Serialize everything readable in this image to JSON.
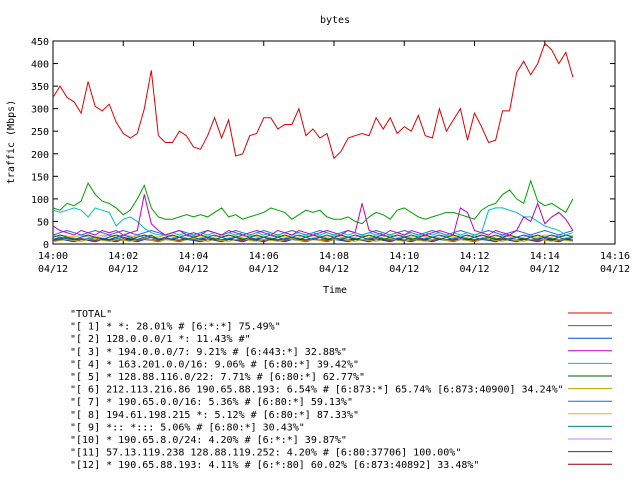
{
  "chart_data": {
    "type": "line",
    "title": "bytes",
    "xlabel": "Time",
    "ylabel": "traffic (Mbps)",
    "ylim": [
      0,
      450
    ],
    "yticks": [
      0,
      50,
      100,
      150,
      200,
      250,
      300,
      350,
      400,
      450
    ],
    "xlim_minutes": [
      0,
      16
    ],
    "xticks": [
      {
        "time": "14:00",
        "date": "04/12"
      },
      {
        "time": "14:02",
        "date": "04/12"
      },
      {
        "time": "14:04",
        "date": "04/12"
      },
      {
        "time": "14:06",
        "date": "04/12"
      },
      {
        "time": "14:08",
        "date": "04/12"
      },
      {
        "time": "14:10",
        "date": "04/12"
      },
      {
        "time": "14:12",
        "date": "04/12"
      },
      {
        "time": "14:14",
        "date": "04/12"
      },
      {
        "time": "14:16",
        "date": "04/12"
      }
    ],
    "x_minutes": [
      0,
      0.2,
      0.4,
      0.6,
      0.8,
      1,
      1.2,
      1.4,
      1.6,
      1.8,
      2,
      2.2,
      2.4,
      2.6,
      2.8,
      3,
      3.2,
      3.4,
      3.6,
      3.8,
      4,
      4.2,
      4.4,
      4.6,
      4.8,
      5,
      5.2,
      5.4,
      5.6,
      5.8,
      6,
      6.2,
      6.4,
      6.6,
      6.8,
      7,
      7.2,
      7.4,
      7.6,
      7.8,
      8,
      8.2,
      8.4,
      8.6,
      8.8,
      9,
      9.2,
      9.4,
      9.6,
      9.8,
      10,
      10.2,
      10.4,
      10.6,
      10.8,
      11,
      11.2,
      11.4,
      11.6,
      11.8,
      12,
      12.2,
      12.4,
      12.6,
      12.8,
      13,
      13.2,
      13.4,
      13.6,
      13.8,
      14,
      14.2,
      14.4,
      14.6,
      14.8
    ],
    "series": [
      {
        "name": "\"TOTAL\"",
        "color": "#e00000",
        "values": [
          325,
          350,
          325,
          315,
          290,
          360,
          305,
          295,
          310,
          270,
          245,
          235,
          245,
          300,
          385,
          240,
          225,
          225,
          250,
          240,
          215,
          210,
          240,
          280,
          235,
          275,
          195,
          200,
          240,
          245,
          280,
          280,
          255,
          265,
          265,
          300,
          240,
          255,
          235,
          245,
          190,
          205,
          235,
          240,
          245,
          240,
          280,
          255,
          280,
          245,
          260,
          250,
          285,
          240,
          235,
          300,
          250,
          275,
          300,
          230,
          290,
          260,
          225,
          230,
          295,
          295,
          380,
          405,
          375,
          400,
          445,
          430,
          400,
          425,
          370,
          365,
          335,
          310,
          375,
          370,
          360,
          270,
          385,
          375,
          355,
          350,
          345,
          365,
          310
        ]
      },
      {
        "name": "\"[ 1] * *: 28.01% # [6:*:*] 75.49%\"",
        "color": "#00a000",
        "values": [
          80,
          75,
          90,
          85,
          95,
          135,
          110,
          95,
          90,
          80,
          65,
          75,
          100,
          130,
          80,
          60,
          55,
          55,
          60,
          65,
          60,
          65,
          60,
          70,
          80,
          60,
          65,
          55,
          60,
          65,
          70,
          80,
          75,
          70,
          55,
          65,
          75,
          70,
          75,
          60,
          55,
          55,
          60,
          50,
          45,
          60,
          70,
          65,
          55,
          75,
          80,
          70,
          60,
          55,
          60,
          65,
          70,
          70,
          65,
          60,
          55,
          75,
          85,
          90,
          110,
          120,
          100,
          90,
          140,
          95,
          85,
          90,
          80,
          70,
          100,
          115,
          80,
          95,
          110,
          90,
          110,
          100,
          110,
          95
        ]
      },
      {
        "name": "\"[ 2] 128.0.0.0/1 *: 11.43% #\"",
        "color": "#0055cc",
        "values": [
          10,
          15,
          12,
          10,
          15,
          20,
          15,
          12,
          10,
          15,
          20,
          15,
          10,
          15,
          20,
          10,
          15,
          10,
          15,
          20,
          15,
          10,
          15,
          20,
          15,
          10,
          15,
          20,
          15,
          10,
          15,
          20,
          15,
          10,
          15,
          20,
          15,
          10,
          15,
          20,
          15,
          10,
          15,
          20,
          15,
          10,
          15,
          20,
          15,
          10,
          15,
          20,
          15,
          10,
          15,
          20,
          15,
          10,
          15,
          20,
          15,
          10,
          15,
          20,
          15,
          10,
          15,
          20,
          15,
          10,
          15,
          20,
          15,
          10,
          15,
          20,
          15,
          10,
          15,
          20,
          15,
          10,
          15,
          20,
          15
        ]
      },
      {
        "name": "\"[ 3] * 194.0.0.0/7: 9.21% # [6:443:*] 32.88%\"",
        "color": "#c000c0",
        "values": [
          40,
          30,
          25,
          20,
          30,
          25,
          20,
          30,
          25,
          30,
          20,
          25,
          30,
          110,
          45,
          30,
          20,
          25,
          30,
          20,
          25,
          20,
          30,
          25,
          20,
          30,
          25,
          20,
          25,
          30,
          25,
          20,
          30,
          25,
          20,
          30,
          25,
          20,
          25,
          30,
          25,
          20,
          30,
          25,
          90,
          30,
          25,
          20,
          30,
          25,
          20,
          30,
          25,
          20,
          25,
          30,
          25,
          20,
          80,
          70,
          30,
          25,
          20,
          30,
          25,
          20,
          30,
          60,
          50,
          90,
          45,
          60,
          70,
          55,
          30,
          20,
          25,
          40,
          60,
          55,
          35,
          45,
          60,
          45
        ]
      },
      {
        "name": "\"[ 4] * 163.201.0.0/16: 9.06% # [6:80:*] 39.42%\"",
        "color": "#00c0c0",
        "values": [
          75,
          70,
          75,
          80,
          75,
          60,
          80,
          75,
          70,
          40,
          55,
          60,
          50,
          35,
          25,
          20,
          20,
          25,
          20,
          25,
          20,
          25,
          20,
          25,
          20,
          25,
          20,
          25,
          20,
          25,
          20,
          25,
          20,
          25,
          20,
          25,
          20,
          25,
          20,
          25,
          20,
          25,
          20,
          25,
          20,
          25,
          20,
          25,
          20,
          25,
          20,
          25,
          20,
          25,
          20,
          25,
          20,
          25,
          20,
          25,
          20,
          25,
          75,
          80,
          80,
          75,
          70,
          60,
          60,
          50,
          40,
          35,
          30,
          20,
          25,
          30,
          25,
          30,
          25,
          20,
          25,
          30,
          20,
          25
        ]
      },
      {
        "name": "\"[ 5] * 128.88.116.0/22: 7.71% # [6:80:*] 62.77%\"",
        "color": "#006000",
        "values": [
          15,
          20,
          15,
          10,
          15,
          20,
          15,
          10,
          15,
          20,
          15,
          10,
          15,
          20,
          15,
          10,
          15,
          20,
          15,
          10,
          15,
          20,
          15,
          10,
          15,
          20,
          15,
          10,
          15,
          20,
          15,
          10,
          15,
          20,
          15,
          10,
          15,
          20,
          15,
          10,
          15,
          20,
          15,
          10,
          15,
          20,
          15,
          10,
          15,
          20,
          15,
          10,
          15,
          20,
          15,
          10,
          15,
          20,
          15,
          10,
          15,
          20,
          15,
          10,
          15,
          20,
          15,
          10,
          15,
          20,
          15,
          10,
          15,
          20,
          15,
          10,
          15,
          20,
          15,
          10,
          15,
          20,
          15,
          10
        ]
      },
      {
        "name": "\"[ 6] 212.113.216.86 190.65.88.193: 6.54% # [6:873:*] 65.74% [6:873:40900] 34.24%\"",
        "color": "#c0a000",
        "values": [
          5,
          8,
          10,
          8,
          6,
          10,
          12,
          8,
          6,
          10,
          8,
          6,
          10,
          12,
          8,
          6,
          10,
          8,
          6,
          10,
          12,
          8,
          6,
          10,
          8,
          6,
          10,
          12,
          8,
          6,
          10,
          8,
          6,
          10,
          12,
          8,
          6,
          10,
          8,
          6,
          10,
          12,
          8,
          6,
          10,
          8,
          6,
          10,
          12,
          8,
          6,
          10,
          8,
          6,
          10,
          12,
          8,
          6,
          10,
          8,
          6,
          10,
          12,
          8,
          6,
          10,
          8,
          6,
          10,
          12,
          8,
          6,
          10,
          8,
          6,
          10,
          12,
          8,
          6,
          10,
          8,
          6,
          10,
          12
        ]
      },
      {
        "name": "\"[ 7] * 190.65.0.0/16: 5.36% # [6:80:*] 59.13%\"",
        "color": "#2060e0",
        "values": [
          20,
          25,
          30,
          25,
          20,
          25,
          30,
          25,
          20,
          25,
          30,
          25,
          20,
          25,
          30,
          25,
          20,
          25,
          30,
          25,
          20,
          25,
          30,
          25,
          20,
          25,
          30,
          25,
          20,
          25,
          30,
          25,
          20,
          25,
          30,
          25,
          20,
          25,
          30,
          25,
          20,
          25,
          30,
          25,
          20,
          25,
          30,
          25,
          20,
          25,
          30,
          25,
          20,
          25,
          30,
          25,
          20,
          25,
          30,
          25,
          20,
          25,
          30,
          25,
          20,
          25,
          30,
          25,
          20,
          25,
          30,
          25,
          20,
          25,
          30,
          25,
          20,
          25,
          30,
          25,
          20,
          25,
          30,
          25
        ]
      },
      {
        "name": "\"[ 8] 194.61.198.215 *: 5.12% # [6:80:*] 87.33%\"",
        "color": "#ffb000",
        "values": [
          15,
          20,
          18,
          15,
          20,
          18,
          15,
          20,
          18,
          15,
          20,
          18,
          15,
          20,
          18,
          15,
          20,
          18,
          15,
          20,
          18,
          15,
          20,
          18,
          15,
          20,
          18,
          15,
          20,
          18,
          15,
          20,
          18,
          15,
          20,
          18,
          15,
          20,
          18,
          15,
          20,
          18,
          15,
          20,
          18,
          15,
          20,
          18,
          15,
          20,
          18,
          15,
          20,
          18,
          15,
          20,
          18,
          15,
          20,
          18,
          15,
          20,
          18,
          15,
          20,
          18,
          15,
          20,
          18,
          15,
          20,
          18,
          15,
          20,
          18,
          15,
          20,
          18,
          15,
          20,
          18,
          15,
          20,
          18
        ]
      },
      {
        "name": "\"[ 9] *:: *::: 5.06% # [6:80:*] 30.43%\"",
        "color": "#008080",
        "values": [
          10,
          12,
          15,
          12,
          10,
          12,
          15,
          12,
          10,
          12,
          15,
          12,
          10,
          12,
          15,
          12,
          10,
          12,
          15,
          12,
          10,
          12,
          15,
          12,
          10,
          12,
          15,
          12,
          10,
          12,
          15,
          12,
          10,
          12,
          15,
          12,
          10,
          12,
          15,
          12,
          10,
          12,
          15,
          12,
          10,
          12,
          15,
          12,
          10,
          12,
          15,
          12,
          10,
          12,
          15,
          12,
          10,
          12,
          15,
          12,
          10,
          12,
          15,
          12,
          10,
          12,
          15,
          12,
          10,
          12,
          15,
          12,
          10,
          12,
          15,
          12,
          10,
          12,
          15,
          12,
          10,
          12,
          15,
          12
        ]
      },
      {
        "name": "\"[10] * 190.65.8.0/24: 4.20% # [6:*:*] 39.87%\"",
        "color": "#c080ff",
        "values": [
          20,
          15,
          10,
          15,
          20,
          15,
          10,
          15,
          20,
          15,
          10,
          15,
          20,
          15,
          10,
          15,
          20,
          15,
          10,
          15,
          20,
          15,
          10,
          15,
          20,
          15,
          10,
          15,
          20,
          15,
          10,
          15,
          20,
          15,
          10,
          15,
          20,
          15,
          10,
          15,
          20,
          15,
          10,
          15,
          20,
          15,
          10,
          15,
          20,
          15,
          10,
          15,
          20,
          15,
          10,
          15,
          20,
          15,
          10,
          15,
          20,
          15,
          10,
          15,
          20,
          15,
          10,
          15,
          20,
          15,
          10,
          15,
          20,
          15,
          10,
          15,
          20,
          15,
          10,
          15,
          20,
          15,
          10,
          15
        ]
      },
      {
        "name": "\"[11] 57.13.119.238 128.88.119.252: 4.20% # [6:80:37706] 100.00%\"",
        "color": "#1040a0",
        "values": [
          5,
          10,
          8,
          5,
          10,
          8,
          5,
          10,
          8,
          5,
          10,
          8,
          5,
          10,
          8,
          5,
          10,
          8,
          5,
          10,
          8,
          5,
          10,
          8,
          5,
          10,
          8,
          5,
          10,
          8,
          5,
          10,
          8,
          5,
          10,
          8,
          5,
          10,
          8,
          5,
          10,
          8,
          5,
          10,
          8,
          5,
          10,
          8,
          5,
          10,
          8,
          5,
          10,
          8,
          5,
          10,
          8,
          5,
          10,
          8,
          5,
          10,
          8,
          5,
          10,
          8,
          5,
          10,
          8,
          5,
          10,
          8,
          5,
          10,
          8,
          5,
          10,
          8,
          5,
          10,
          8,
          5,
          10,
          8
        ]
      },
      {
        "name": "\"[12] * 190.65.88.193: 4.11% # [6:*:80] 60.02% [6:873:40892] 33.48%\"",
        "color": "#900000",
        "values": [
          8,
          12,
          10,
          8,
          12,
          10,
          8,
          12,
          10,
          8,
          12,
          10,
          8,
          12,
          10,
          8,
          12,
          10,
          8,
          12,
          10,
          8,
          12,
          10,
          8,
          12,
          10,
          8,
          12,
          10,
          8,
          12,
          10,
          8,
          12,
          10,
          8,
          12,
          10,
          8,
          12,
          10,
          8,
          12,
          10,
          8,
          12,
          10,
          8,
          12,
          10,
          8,
          12,
          10,
          8,
          12,
          10,
          8,
          12,
          10,
          8,
          12,
          10,
          8,
          12,
          10,
          8,
          12,
          10,
          8,
          12,
          10,
          8,
          12,
          10,
          8,
          12,
          10,
          8,
          12,
          10,
          8,
          12,
          10
        ]
      }
    ],
    "grid": false,
    "legend_position": "bottom"
  }
}
